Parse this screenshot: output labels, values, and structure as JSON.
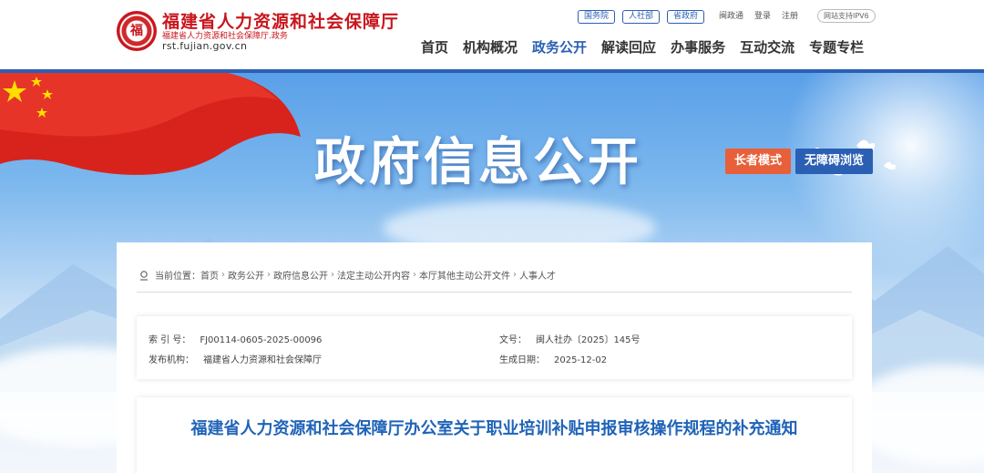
{
  "header": {
    "site_title": "福建省人力资源和社会保障厅",
    "site_subtitle": "福建省人力资源和社会保障厅.政务",
    "domain": "rst.fujian.gov.cn",
    "seal_char": "福",
    "pills": [
      "国务院",
      "人社部",
      "省政府"
    ],
    "links": [
      "闽政通",
      "登录",
      "注册"
    ],
    "ipv6": "网站支持IPV6",
    "nav": [
      "首页",
      "机构概况",
      "政务公开",
      "解读回应",
      "办事服务",
      "互动交流",
      "专题专栏"
    ],
    "nav_active": "政务公开",
    "brand_color": "#c8161d",
    "accent_color": "#2a5fb3"
  },
  "banner": {
    "title": "政府信息公开",
    "elder_mode": "长者模式",
    "accessible": "无障碍浏览"
  },
  "breadcrumb": {
    "label": "当前位置：",
    "items": [
      "首页",
      "政务公开",
      "政府信息公开",
      "法定主动公开内容",
      "本厅其他主动公开文件",
      "人事人才"
    ]
  },
  "meta": {
    "index_label": "索 引 号：",
    "index_value": "FJ00114-0605-2025-00096",
    "publisher_label": "发布机构：",
    "publisher_value": "福建省人力资源和社会保障厅",
    "doc_label": "文号：",
    "doc_value": "闽人社办〔2025〕145号",
    "date_label": "生成日期：",
    "date_value": "2025-12-02"
  },
  "article": {
    "title": "福建省人力资源和社会保障厅办公室关于职业培训补贴申报审核操作规程的补充通知"
  }
}
